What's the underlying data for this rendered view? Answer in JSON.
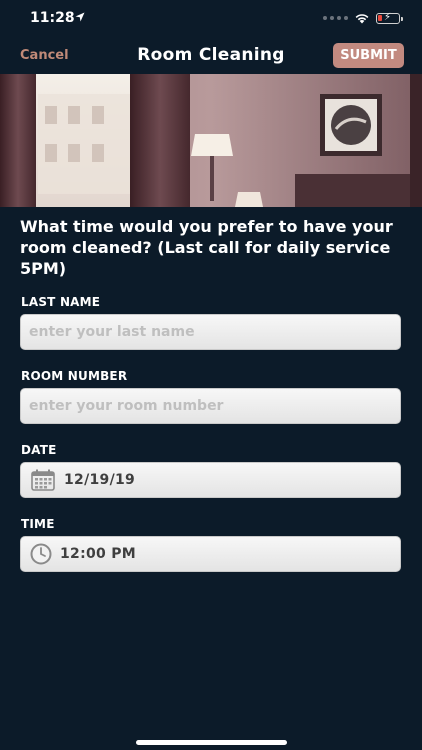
{
  "status_bar": {
    "time": "11:28"
  },
  "nav": {
    "cancel_label": "Cancel",
    "title": "Room Cleaning",
    "submit_label": "SUBMIT"
  },
  "question": "What time would you prefer to have your room cleaned? (Last call for daily service 5PM)",
  "fields": {
    "last_name": {
      "label": "LAST NAME",
      "placeholder": "enter your last name",
      "value": ""
    },
    "room_number": {
      "label": "ROOM NUMBER",
      "placeholder": "enter your room number",
      "value": ""
    },
    "date": {
      "label": "DATE",
      "value": "12/19/19"
    },
    "time": {
      "label": "TIME",
      "value": "12:00 PM"
    }
  },
  "colors": {
    "background": "#0c1b29",
    "accent": "#c28a80",
    "cancel_text": "#c08a78"
  },
  "icons": {
    "location": "location-arrow-icon",
    "wifi": "wifi-icon",
    "battery": "battery-charging-icon",
    "date": "calendar-icon",
    "time": "clock-icon"
  }
}
